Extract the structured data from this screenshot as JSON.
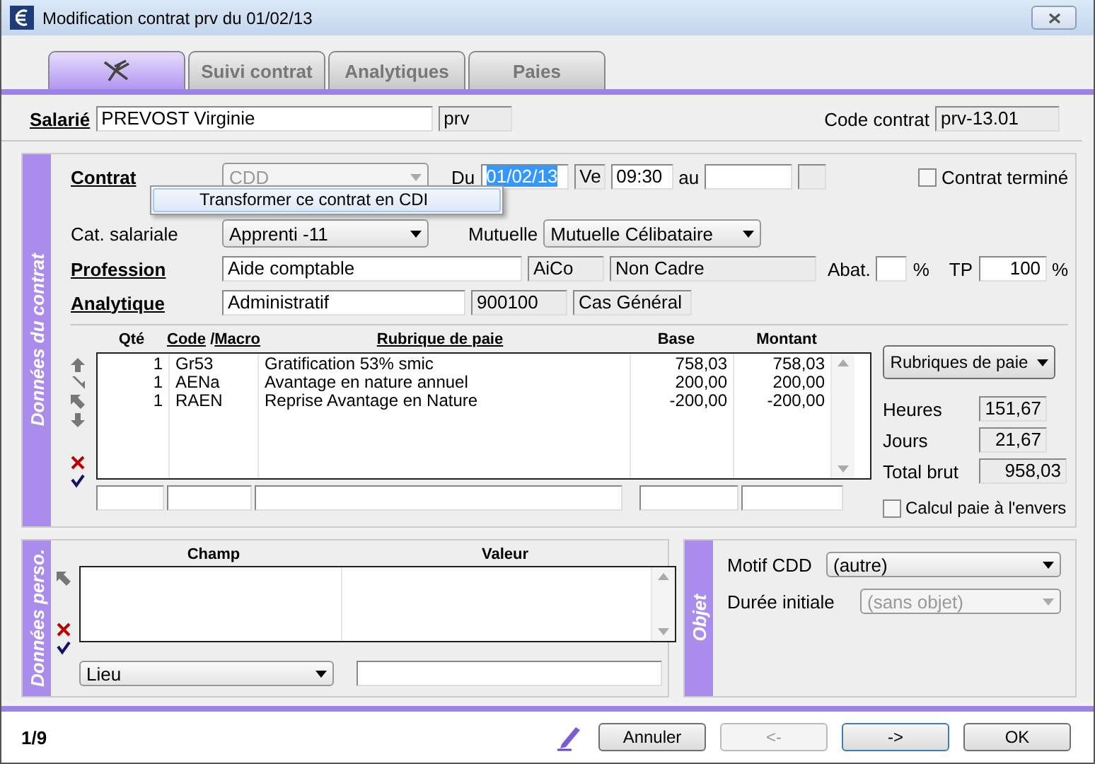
{
  "window": {
    "title": "Modification contrat prv du 01/02/13"
  },
  "tabs": [
    {
      "kind": "icon",
      "selected": true
    },
    {
      "kind": "text",
      "label": "Suivi contrat",
      "selected": false
    },
    {
      "kind": "text",
      "label": "Analytiques",
      "selected": false
    },
    {
      "kind": "text",
      "label": "Paies",
      "selected": false
    }
  ],
  "salarie": {
    "label": "Salarié",
    "name": "PREVOST Virginie",
    "code": "prv"
  },
  "code_contrat": {
    "label": "Code contrat",
    "value": "prv-13.01"
  },
  "contract_section": {
    "title": "Données du contrat",
    "contrat": {
      "label": "Contrat",
      "value": "CDD",
      "disabled": true
    },
    "du": {
      "label": "Du",
      "date": "01/02/13",
      "date_selected": true,
      "day": "Ve",
      "time": "09:30"
    },
    "au": {
      "label": "au"
    },
    "termine": {
      "label": "Contrat terminé",
      "checked": false
    },
    "cat": {
      "label": "Cat. salariale",
      "value": "Apprenti -11"
    },
    "mutuelle": {
      "label": "Mutuelle",
      "value": "Mutuelle Célibataire"
    },
    "profession": {
      "label": "Profession",
      "value": "Aide comptable",
      "code": "AiCo",
      "status": "Non Cadre"
    },
    "abat": {
      "label": "Abat.",
      "unit": "%"
    },
    "tp": {
      "label": "TP",
      "value": "100",
      "unit": "%"
    },
    "analytique": {
      "label": "Analytique",
      "value": "Administratif",
      "code": "900100",
      "case": "Cas Général"
    },
    "table": {
      "columns": [
        {
          "label": "Qté"
        },
        {
          "links": [
            "Code",
            "Macro"
          ],
          "sep": "/"
        },
        {
          "label": "Rubrique de paie",
          "link": true
        },
        {
          "label": "Base"
        },
        {
          "label": "Montant"
        }
      ],
      "rows": [
        {
          "qty": "1",
          "code": "Gr53",
          "label": "Gratification 53% smic",
          "base": "758,03",
          "montant": "758,03"
        },
        {
          "qty": "1",
          "code": "AENa",
          "label": "Avantage en nature annuel",
          "base": "200,00",
          "montant": "200,00"
        },
        {
          "qty": "1",
          "code": "RAEN",
          "label": "Reprise Avantage en Nature",
          "base": "-200,00",
          "montant": "-200,00"
        }
      ]
    },
    "rubriques_button": "Rubriques de paie",
    "totals": [
      {
        "label": "Heures",
        "value": "151,67"
      },
      {
        "label": "Jours",
        "value": "21,67"
      },
      {
        "label": "Total brut",
        "value": "958,03"
      }
    ],
    "calcul_envers": {
      "label": "Calcul paie à l'envers",
      "checked": false
    }
  },
  "context_menu": {
    "items": [
      "Transformer ce contrat en CDI"
    ]
  },
  "perso_section": {
    "title": "Données perso.",
    "columns": [
      "Champ",
      "Valeur"
    ],
    "field_select": "Lieu"
  },
  "objet_section": {
    "title": "Objet",
    "motif": {
      "label": "Motif CDD",
      "value": "(autre)",
      "disabled": false
    },
    "duree": {
      "label": "Durée initiale",
      "value": "(sans objet)",
      "disabled": true
    }
  },
  "footer": {
    "counter": "1/9",
    "buttons": [
      {
        "label": "Annuler",
        "disabled": false,
        "focused": false
      },
      {
        "label": "<-",
        "disabled": true,
        "focused": false
      },
      {
        "label": "->",
        "disabled": false,
        "focused": true
      },
      {
        "label": "OK",
        "disabled": false,
        "focused": false
      }
    ]
  }
}
